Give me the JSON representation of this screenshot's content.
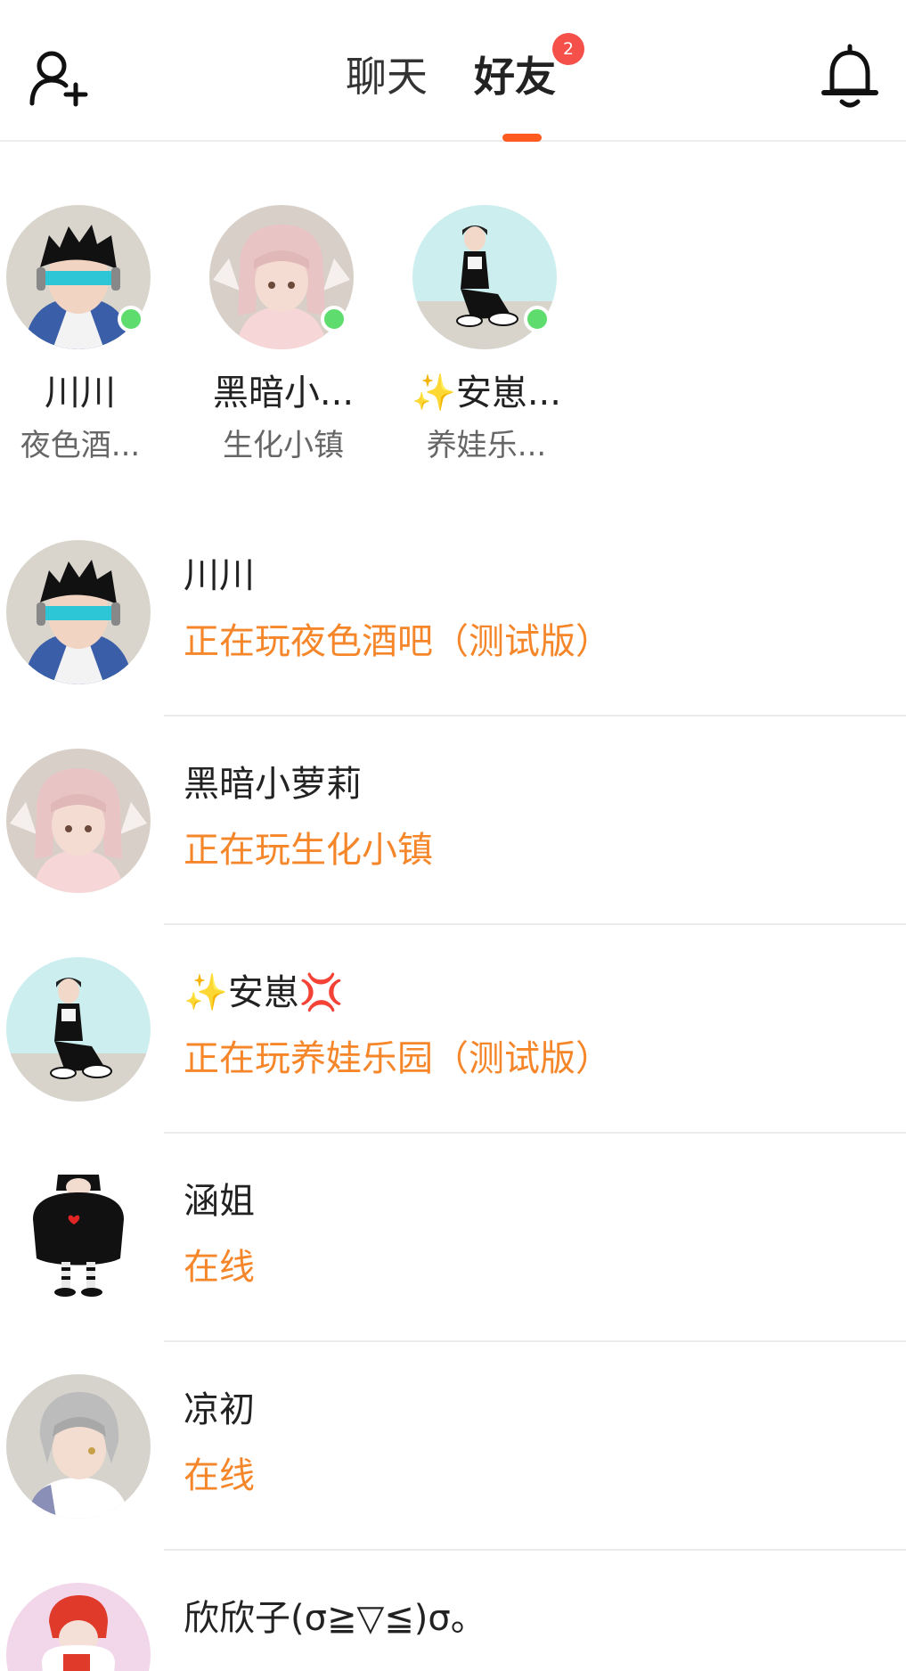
{
  "header": {
    "tabs": [
      {
        "label": "聊天",
        "active": false
      },
      {
        "label": "好友",
        "active": true,
        "badge": "2"
      }
    ],
    "add_friend_icon": "add-user-icon",
    "notification_icon": "bell-icon"
  },
  "online_friends": [
    {
      "name": "川川",
      "game": "夜色酒...",
      "online": true
    },
    {
      "name": "黑暗小...",
      "game": "生化小镇",
      "online": true
    },
    {
      "name_prefix": "✨",
      "name": "安崽...",
      "game": "养娃乐...",
      "online": true
    }
  ],
  "friends": [
    {
      "name": "川川",
      "status": "正在玩夜色酒吧（测试版）"
    },
    {
      "name": "黑暗小萝莉",
      "status": "正在玩生化小镇"
    },
    {
      "name_prefix": "✨",
      "name": "安崽",
      "name_suffix": "💢",
      "status": "正在玩养娃乐园（测试版）"
    },
    {
      "name": "涵姐",
      "status": "在线"
    },
    {
      "name": "凉初",
      "status": "在线"
    },
    {
      "name": "欣欣子(σ≧▽≦)σ。",
      "status": ""
    }
  ],
  "colors": {
    "accent": "#ff5a1f",
    "status_text": "#f5862a",
    "online_dot": "#5fdc6e",
    "badge": "#f5504a"
  }
}
